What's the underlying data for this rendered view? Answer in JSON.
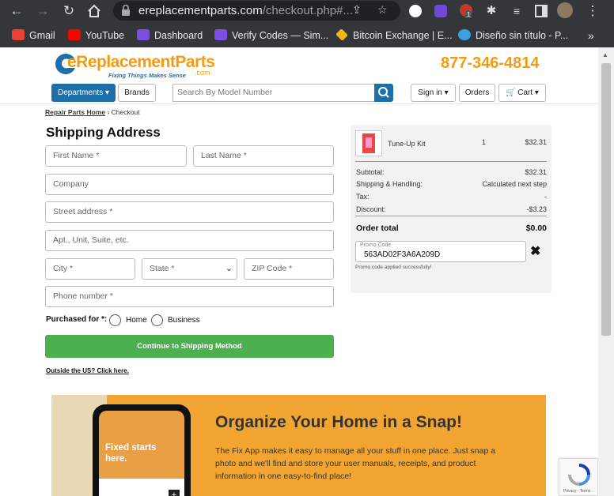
{
  "browser": {
    "url_main": "ereplacementparts.com",
    "url_path": "/checkout.php#...",
    "ext_badge": "1",
    "bookmarks": [
      "Gmail",
      "YouTube",
      "Dashboard",
      "Verify Codes — Sim...",
      "Bitcoin Exchange | E...",
      "Diseño sin título - P..."
    ],
    "bookmarks_more": "»"
  },
  "header": {
    "logo_text": "eReplacementParts",
    "logo_tld": ".com",
    "tagline": "Fixing Things Makes Sense",
    "phone": "877-346-4814",
    "departments": "Departments",
    "brands": "Brands",
    "search_placeholder": "Search By Model Number",
    "sign_in": "Sign in",
    "orders": "Orders",
    "cart": "Cart"
  },
  "breadcrumb": {
    "home": "Repair Parts Home",
    "sep": "›",
    "current": "Checkout"
  },
  "shipping": {
    "title": "Shipping Address",
    "first_name": "First Name *",
    "last_name": "Last Name *",
    "company": "Company",
    "street": "Street address *",
    "apt": "Apt., Unit, Suite, etc.",
    "city": "City *",
    "state": "State *",
    "zip": "ZIP Code *",
    "phone": "Phone number *",
    "purchased_for": "Purchased for *:",
    "home": "Home",
    "business": "Business",
    "continue": "Continue to Shipping Method",
    "outside": "Outside the US? Click here."
  },
  "summary": {
    "item_name": "Tune-Up Kit",
    "item_qty": "1",
    "item_price": "$32.31",
    "subtotal_label": "Subtotal:",
    "subtotal": "$32.31",
    "shipping_label": "Shipping & Handling:",
    "shipping": "Calculated next step",
    "tax_label": "Tax:",
    "tax": "-",
    "discount_label": "Discount:",
    "discount": "-$3.23",
    "total_label": "Order total",
    "total": "$0.00",
    "promo_label": "Promo Code",
    "promo_value": "563AD02F3A6A209D",
    "promo_msg": "Promo code applied successfully!"
  },
  "banner": {
    "phone_text": "Fixed starts here.",
    "heading": "Organize Your Home in a Snap!",
    "body": "The Fix App makes it easy to manage all your stuff in one place. Just snap a photo and we'll find and store your user manuals, receipts, and product information in one easy-to-find place!"
  },
  "recaptcha": {
    "terms": "Privacy - Terms"
  }
}
